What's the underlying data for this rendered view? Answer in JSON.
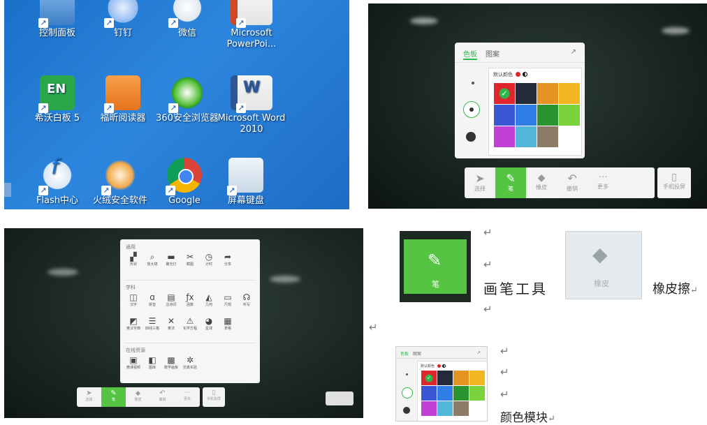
{
  "desktop": {
    "icons": [
      {
        "label": "控制面板",
        "icon": "control-panel-icon"
      },
      {
        "label": "钉钉",
        "icon": "dingtalk-icon"
      },
      {
        "label": "微信",
        "icon": "wechat-icon"
      },
      {
        "label": "Microsoft PowerPoi...",
        "icon": "powerpoint-icon"
      },
      {
        "label": "希沃白板 5",
        "icon": "seewo-board-icon"
      },
      {
        "label": "福昕阅读器",
        "icon": "foxit-reader-icon"
      },
      {
        "label": "360安全浏览器",
        "icon": "360-browser-icon"
      },
      {
        "label": "Microsoft Word 2010",
        "icon": "word-icon"
      },
      {
        "label": "Flash中心",
        "icon": "flash-icon"
      },
      {
        "label": "火绒安全软件",
        "icon": "huorong-icon"
      },
      {
        "label": "Google",
        "icon": "chrome-icon"
      },
      {
        "label": "屏幕键盘",
        "icon": "onscreen-keyboard-icon"
      }
    ],
    "shortcut_glyph": "↗"
  },
  "palette_panel": {
    "tabs": [
      "色板",
      "图案"
    ],
    "expand_glyph": "↗",
    "default_color_label": "默认颜色",
    "swatch_colors": [
      "#e0262d",
      "#232a3a",
      "#e59424",
      "#f0b624",
      "#3a56d4",
      "#2e7ee6",
      "#2b9330",
      "#7bd33c",
      "#c23fd6",
      "#52b6d6",
      "#8d7b6a",
      "#ffffff"
    ],
    "accent": "#2fb84a",
    "toolbar": [
      {
        "label": "选择",
        "icon": "cursor-icon"
      },
      {
        "label": "笔",
        "icon": "pen-icon"
      },
      {
        "label": "橡皮",
        "icon": "eraser-icon"
      },
      {
        "label": "撤销",
        "icon": "undo-icon"
      },
      {
        "label": "更多",
        "icon": "more-icon"
      },
      {
        "label": "手机投屏",
        "icon": "phone-cast-icon"
      }
    ]
  },
  "more_menu": {
    "sections": [
      {
        "title": "通用",
        "items": [
          {
            "label": "形状",
            "glyph": "▞"
          },
          {
            "label": "放大镜",
            "glyph": "⌕"
          },
          {
            "label": "聚光灯",
            "glyph": "▬"
          },
          {
            "label": "截图",
            "glyph": "✂"
          },
          {
            "label": "计时",
            "glyph": "◷"
          },
          {
            "label": "分享",
            "glyph": "➦"
          }
        ]
      },
      {
        "title": "学科",
        "items": [
          {
            "label": "汉字",
            "glyph": "◫"
          },
          {
            "label": "拼音",
            "glyph": "ɑ"
          },
          {
            "label": "古诗词",
            "glyph": "▤"
          },
          {
            "label": "函数",
            "glyph": "ƒx"
          },
          {
            "label": "几何",
            "glyph": "◭"
          },
          {
            "label": "尺规",
            "glyph": "▭"
          },
          {
            "label": "听写",
            "glyph": "☊"
          },
          {
            "label": "英汉字典",
            "glyph": "◩"
          },
          {
            "label": "四线三格",
            "glyph": "☰"
          },
          {
            "label": "乘法",
            "glyph": "✕"
          },
          {
            "label": "化学方程",
            "glyph": "⚠"
          },
          {
            "label": "星球",
            "glyph": "◕"
          },
          {
            "label": "表格",
            "glyph": "▦"
          }
        ]
      },
      {
        "title": "在线资源",
        "items": [
          {
            "label": "微课视频",
            "glyph": "▣"
          },
          {
            "label": "图库",
            "glyph": "◧"
          },
          {
            "label": "数学画板",
            "glyph": "▩"
          },
          {
            "label": "仿真实验",
            "glyph": "✲"
          }
        ]
      }
    ]
  },
  "doc": {
    "pen_button_label": "笔",
    "pen_caption": "画笔工具",
    "eraser_button_label": "橡皮",
    "eraser_caption": "橡皮擦",
    "color_caption": "颜色模块",
    "return_mark": "↵"
  }
}
